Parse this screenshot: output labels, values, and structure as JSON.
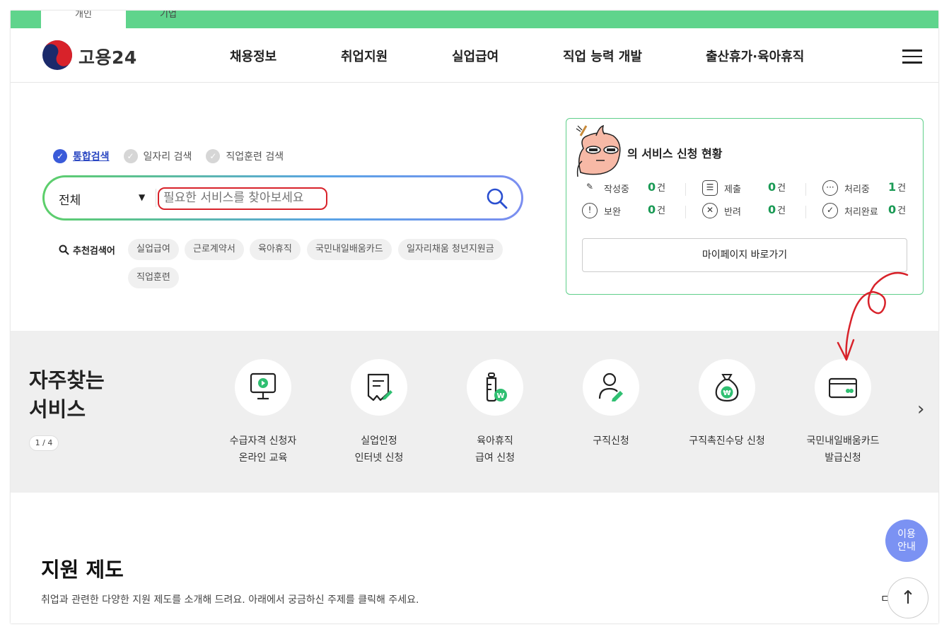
{
  "top_tabs": {
    "personal": "개인",
    "business": "기업"
  },
  "header": {
    "logo_text": "고용24",
    "nav": [
      "채용정보",
      "취업지원",
      "실업급여",
      "직업 능력 개발",
      "출산휴가·육아휴직"
    ],
    "menu_icon": "hamburger-icon"
  },
  "search": {
    "tabs": [
      "통합검색",
      "일자리 검색",
      "직업훈련 검색"
    ],
    "scope": "전체",
    "placeholder": "필요한 서비스를 찾아보세요",
    "recommend_label": "추천검색어",
    "recommend": [
      "실업급여",
      "근로계약서",
      "육아휴직",
      "국민내일배움카드",
      "일자리채움 청년지원금",
      "직업훈련"
    ]
  },
  "status": {
    "title_suffix": "의 서비스 신청 현황",
    "unit": "건",
    "items": [
      {
        "label": "작성중",
        "count": "0"
      },
      {
        "label": "제출",
        "count": "0"
      },
      {
        "label": "처리중",
        "count": "1"
      },
      {
        "label": "보완",
        "count": "0"
      },
      {
        "label": "반려",
        "count": "0"
      },
      {
        "label": "처리완료",
        "count": "0"
      }
    ],
    "mypage_button": "마이페이지 바로가기"
  },
  "favorites": {
    "title_line1": "자주찾는",
    "title_line2": "서비스",
    "pager": "1 / 4",
    "items": [
      {
        "line1": "수급자격 신청자",
        "line2": "온라인 교육",
        "icon": "monitor-play-icon"
      },
      {
        "line1": "실업인정",
        "line2": "인터넷 신청",
        "icon": "document-pen-icon"
      },
      {
        "line1": "육아휴직",
        "line2": "급여 신청",
        "icon": "baby-bottle-won-icon"
      },
      {
        "line1": "구직신청",
        "line2": "",
        "icon": "person-pen-icon"
      },
      {
        "line1": "구직촉진수당 신청",
        "line2": "",
        "icon": "money-bag-icon"
      },
      {
        "line1": "국민내일배움카드",
        "line2": "발급신청",
        "icon": "card-icon"
      }
    ]
  },
  "support": {
    "title": "지원 제도",
    "description": "취업과 관련한 다양한 지원 제도를 소개해 드려요. 아래에서 궁금하신 주제를 클릭해 주세요."
  },
  "floating": {
    "guide_line1": "이용",
    "guide_line2": "안내",
    "top_arrow": "↑"
  },
  "colors": {
    "brand_green": "#5fd48c",
    "status_green": "#1a9a55",
    "guide_blue": "#7b92f3",
    "annotation_red": "#d8222a"
  }
}
